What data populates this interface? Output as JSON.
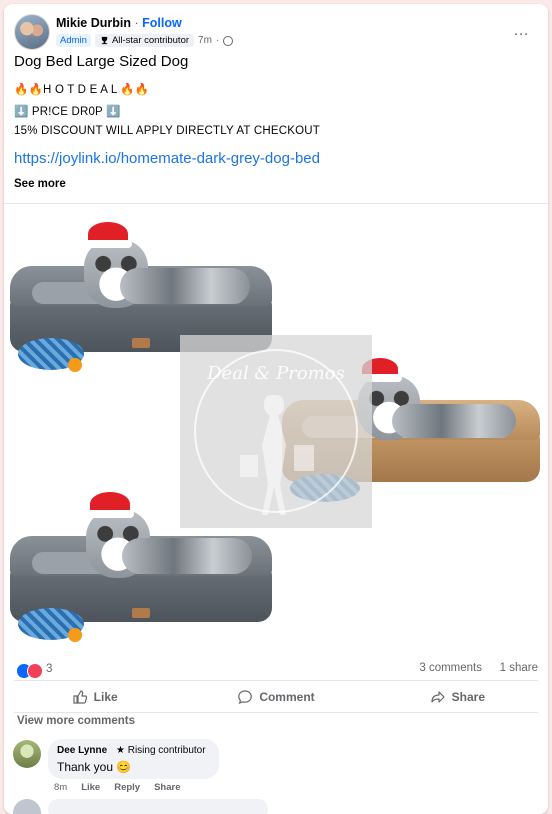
{
  "post": {
    "author": "Mikie Durbin",
    "separator": "·",
    "follow": "Follow",
    "admin_badge": "Admin",
    "contributor_badge": "All-star contributor",
    "time": "7m",
    "title": "Dog Bed Large Sized Dog",
    "line1": "🔥🔥H O T D E A L 🔥🔥",
    "line2": "⬇️ PR!CE DR0P ⬇️",
    "line3": "15% DISCOUNT WILL APPLY DIRECTLY AT CHECKOUT",
    "link": "https://joylink.io/homemate-dark-grey-dog-bed",
    "see_more": "See more",
    "more_icon": "…",
    "watermark_text": "Deal & Promos"
  },
  "stats": {
    "reactions": "3",
    "comments": "3 comments",
    "shares": "1 share"
  },
  "actions": {
    "like": "Like",
    "comment": "Comment",
    "share": "Share"
  },
  "comments": {
    "view_more": "View more comments",
    "items": [
      {
        "author": "Dee Lynne",
        "badge": "Rising contributor",
        "text": "Thank you 😊",
        "time": "8m",
        "like": "Like",
        "reply": "Reply",
        "share": "Share"
      }
    ]
  },
  "colors": {
    "link": "#1b74e4",
    "follow": "#0866ff",
    "like_reaction": "#0866ff",
    "love_reaction": "#f33e58",
    "page_background": "#fbe9e7"
  }
}
